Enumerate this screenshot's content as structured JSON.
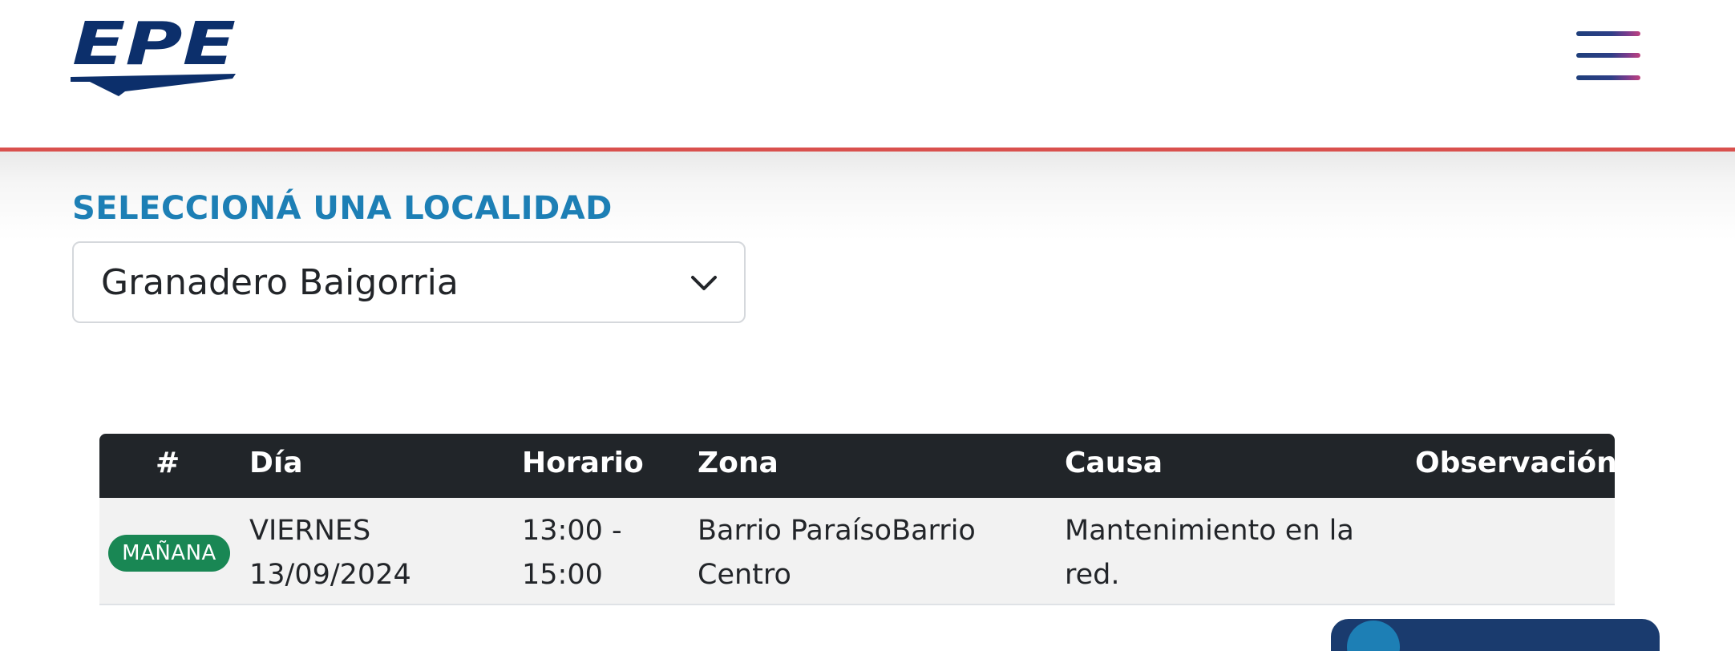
{
  "brand": {
    "logo_text": "EPE",
    "colors": {
      "primary": "#0c2f6b",
      "accent_red": "#d9504d",
      "label_blue": "#1d7fb5",
      "badge_green": "#198754",
      "table_header": "#212529"
    }
  },
  "header": {
    "menu_icon": "hamburger-menu-icon"
  },
  "locality": {
    "label": "SELECCIONÁ UNA LOCALIDAD",
    "selected": "Granadero Baigorria",
    "dropdown_icon": "chevron-down-icon"
  },
  "table": {
    "columns": [
      "#",
      "Día",
      "Horario",
      "Zona",
      "Causa",
      "Observación"
    ],
    "rows": [
      {
        "badge": "MAÑANA",
        "dia_line1": "VIERNES",
        "dia_line2": "13/09/2024",
        "horario_line1": "13:00 -",
        "horario_line2": "15:00",
        "zona_line1": "Barrio ParaísoBarrio",
        "zona_line2": "Centro",
        "causa_line1": "Mantenimiento en la",
        "causa_line2": "red.",
        "observacion": ""
      }
    ]
  }
}
